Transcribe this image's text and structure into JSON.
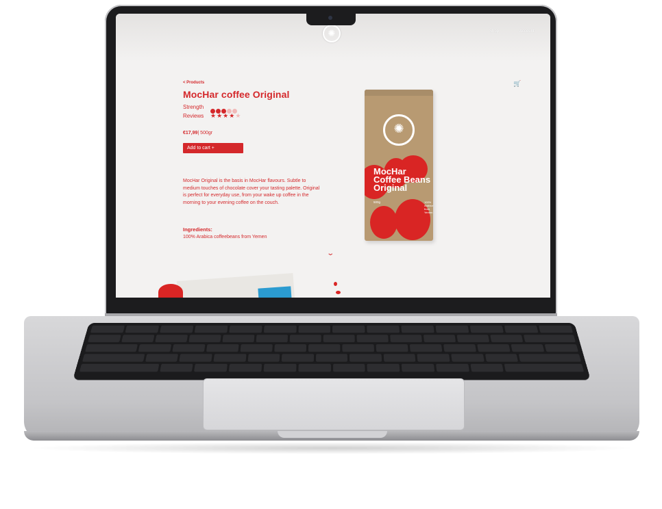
{
  "header": {
    "logo": "mochar-logo-icon",
    "nav": [
      "Shop",
      "Account"
    ],
    "cart_icon": "cart-icon"
  },
  "product": {
    "breadcrumb": "< Products",
    "title": "MocHar coffee Original",
    "strength_label": "Strength",
    "strength_level": 3,
    "strength_max": 5,
    "reviews_label": "Reviews",
    "rating": 4,
    "rating_max": 5,
    "price": "€17,99",
    "weight": "| 500gr",
    "add_to_cart": "Add to cart +",
    "description": "MocHar Original is the basis in MocHar flavours. Subtle to medium touches of chocolate cover your tasting palette. Original is perfect for everyday use, from your wake up coffee in the morning to your evening coffee on the couch.",
    "ingredients_heading": "Ingredients:",
    "ingredients": "100% Arabica coffeebeans from Yemen",
    "scroll_icon": "chevron-down-icon"
  },
  "bag": {
    "title": "MocHar Coffee Beans Original",
    "size": "500g",
    "origin": "100% Arabica from Yemen"
  },
  "colors": {
    "brand_red": "#d4282b",
    "bag_kraft": "#b89a72"
  }
}
